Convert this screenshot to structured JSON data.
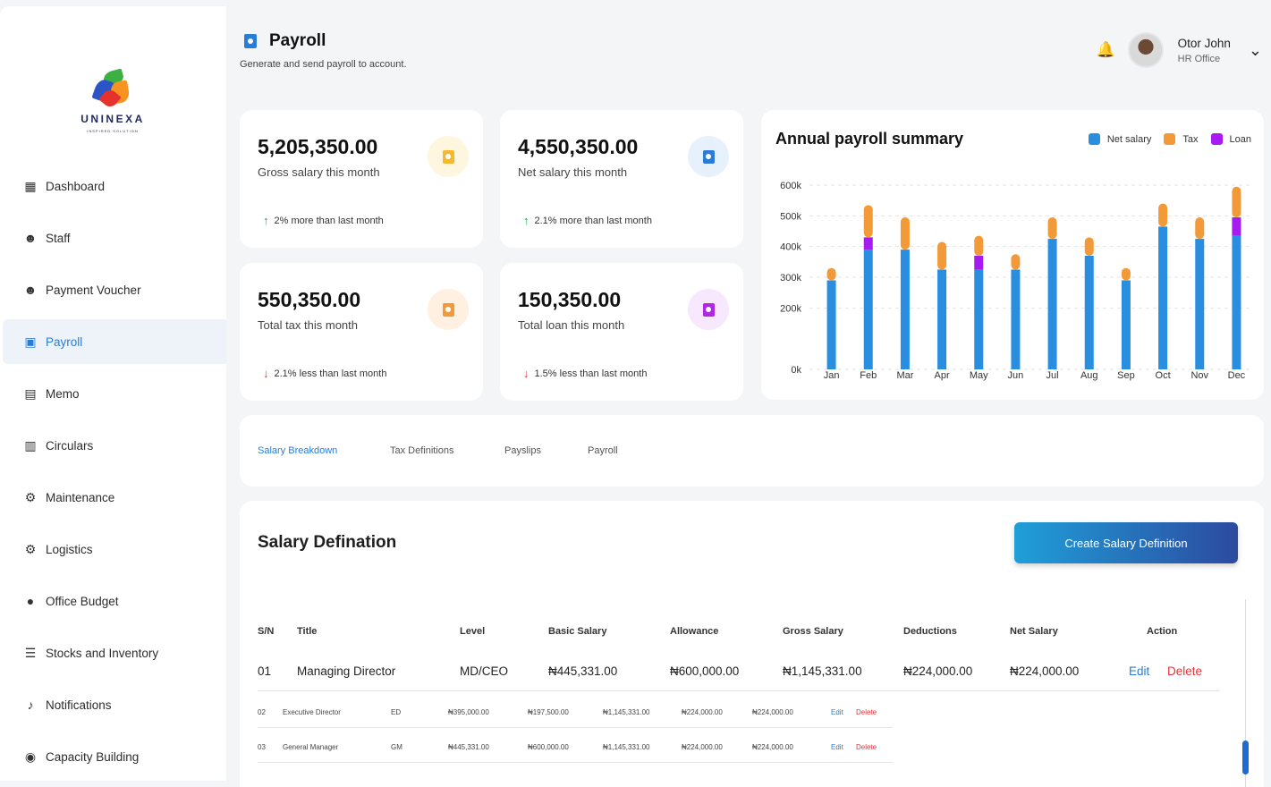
{
  "brand": {
    "name": "UNINEXA",
    "tagline": "INSPIRED SOLUTION"
  },
  "sidebar": {
    "items": [
      {
        "label": "Dashboard",
        "icon": "dashboard-icon",
        "active": false
      },
      {
        "label": "Staff",
        "icon": "staff-icon",
        "active": false
      },
      {
        "label": "Payment Voucher",
        "icon": "voucher-icon",
        "active": false
      },
      {
        "label": "Payroll",
        "icon": "payroll-icon",
        "active": true
      },
      {
        "label": "Memo",
        "icon": "memo-icon",
        "active": false
      },
      {
        "label": "Circulars",
        "icon": "circulars-icon",
        "active": false
      },
      {
        "label": "Maintenance",
        "icon": "maintenance-icon",
        "active": false
      },
      {
        "label": "Logistics",
        "icon": "logistics-icon",
        "active": false
      },
      {
        "label": "Office Budget",
        "icon": "budget-icon",
        "active": false
      },
      {
        "label": "Stocks and Inventory",
        "icon": "inventory-icon",
        "active": false
      },
      {
        "label": "Notifications",
        "icon": "bell-icon",
        "active": false
      },
      {
        "label": "Capacity Building",
        "icon": "capacity-icon",
        "active": false
      }
    ]
  },
  "header": {
    "title": "Payroll",
    "subtitle": "Generate and send payroll to account.",
    "user": {
      "name": "Otor John",
      "role": "HR Office"
    }
  },
  "stats": [
    {
      "value": "5,205,350.00",
      "label": "Gross salary this month",
      "trend": "2% more than last month",
      "direction": "up",
      "color": "#f5b82e",
      "bg": "#fff6e0"
    },
    {
      "value": "4,550,350.00",
      "label": "Net salary this month",
      "trend": "2.1% more than last month",
      "direction": "up",
      "color": "#2a7dd6",
      "bg": "#e6f1fb"
    },
    {
      "value": "550,350.00",
      "label": "Total tax this month",
      "trend": "2.1% less than last month",
      "direction": "down",
      "color": "#f29a38",
      "bg": "#fff0e2"
    },
    {
      "value": "150,350.00",
      "label": "Total loan this month",
      "trend": "1.5% less than last month",
      "direction": "down",
      "color": "#b226e8",
      "bg": "#f7e8fd"
    }
  ],
  "chart_data": {
    "type": "bar",
    "stacked": true,
    "title": "Annual payroll summary",
    "categories": [
      "Jan",
      "Feb",
      "Mar",
      "Apr",
      "May",
      "Jun",
      "Jul",
      "Aug",
      "Sep",
      "Oct",
      "Nov",
      "Dec"
    ],
    "series": [
      {
        "name": "Net salary",
        "color": "#2a8ee0",
        "values": [
          290,
          390,
          390,
          325,
          325,
          325,
          425,
          370,
          290,
          465,
          425,
          435
        ]
      },
      {
        "name": "Loan",
        "color": "#a61bf0",
        "values": [
          0,
          40,
          0,
          0,
          45,
          0,
          0,
          0,
          0,
          0,
          0,
          60
        ]
      },
      {
        "name": "Tax",
        "color": "#f29a38",
        "values": [
          40,
          105,
          105,
          90,
          65,
          50,
          70,
          60,
          40,
          75,
          70,
          100
        ]
      }
    ],
    "legend": [
      "Net salary",
      "Tax",
      "Loan"
    ],
    "legend_position": "top-right",
    "y_ticks": [
      "0k",
      "200k",
      "300k",
      "400k",
      "500k",
      "600k"
    ],
    "ylim": [
      0,
      600
    ],
    "grid": true
  },
  "tabs": [
    "Salary Breakdown",
    "Tax Definitions",
    "Payslips",
    "Payroll"
  ],
  "active_tab": 0,
  "salary": {
    "title": "Salary Defination",
    "create_label": "Create Salary Definition",
    "headers": [
      "S/N",
      "Title",
      "Level",
      "Basic Salary",
      "Allowance",
      "Gross Salary",
      "Deductions",
      "Net Salary",
      "Action"
    ],
    "rows": [
      {
        "sn": "01",
        "title": "Managing Director",
        "level": "MD/CEO",
        "basic": "₦445,331.00",
        "allowance": "₦600,000.00",
        "gross": "₦1,145,331.00",
        "deductions": "₦224,000.00",
        "net": "₦224,000.00",
        "edit": "Edit",
        "delete": "Delete"
      },
      {
        "sn": "02",
        "title": "Executive Director",
        "level": "ED",
        "basic": "₦395,000.00",
        "allowance": "₦197,500.00",
        "gross": "₦1,145,331.00",
        "deductions": "₦224,000.00",
        "net": "₦224,000.00",
        "edit": "Edit",
        "delete": "Delete"
      },
      {
        "sn": "03",
        "title": "General Manager",
        "level": "GM",
        "basic": "₦445,331.00",
        "allowance": "₦600,000.00",
        "gross": "₦1,145,331.00",
        "deductions": "₦224,000.00",
        "net": "₦224,000.00",
        "edit": "Edit",
        "delete": "Delete"
      }
    ]
  }
}
